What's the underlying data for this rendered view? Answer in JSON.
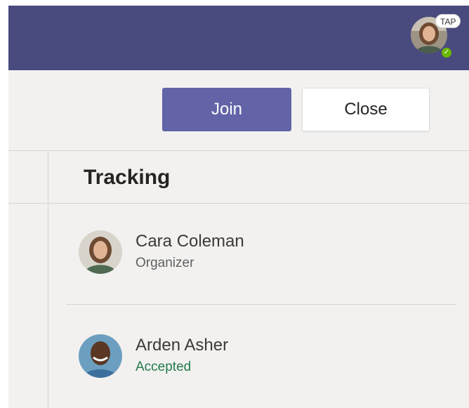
{
  "header": {
    "badge": "TAP",
    "status_color": "#6bb700"
  },
  "actions": {
    "join_label": "Join",
    "close_label": "Close"
  },
  "section": {
    "title": "Tracking"
  },
  "attendees": [
    {
      "name": "Cara Coleman",
      "role": "Organizer",
      "role_color": "#616161"
    },
    {
      "name": "Arden Asher",
      "role": "Accepted",
      "role_color": "#237b4b"
    }
  ],
  "colors": {
    "header_bg": "#494a7e",
    "accent": "#6264a7",
    "panel_bg": "#f2f1f0"
  }
}
